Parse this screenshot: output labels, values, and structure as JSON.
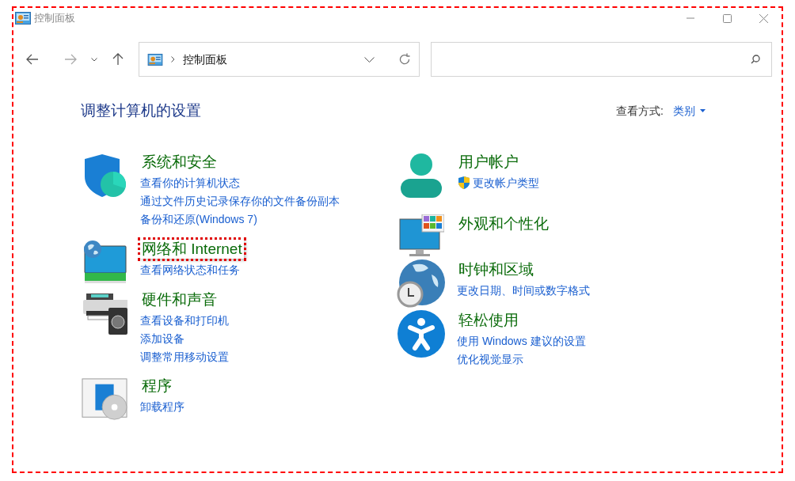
{
  "window": {
    "title": "控制面板"
  },
  "address_bar": {
    "path": "控制面板"
  },
  "heading": "调整计算机的设置",
  "view_by": {
    "label": "查看方式:",
    "value": "类别"
  },
  "columns": [
    [
      {
        "title": "系统和安全",
        "highlighted": false,
        "links": [
          {
            "text": "查看你的计算机状态",
            "shield": false
          },
          {
            "text": "通过文件历史记录保存你的文件备份副本",
            "shield": false
          },
          {
            "text": "备份和还原(Windows 7)",
            "shield": false
          }
        ]
      },
      {
        "title": "网络和 Internet",
        "highlighted": true,
        "links": [
          {
            "text": "查看网络状态和任务",
            "shield": false
          }
        ]
      },
      {
        "title": "硬件和声音",
        "highlighted": false,
        "links": [
          {
            "text": "查看设备和打印机",
            "shield": false
          },
          {
            "text": "添加设备",
            "shield": false
          },
          {
            "text": "调整常用移动设置",
            "shield": false
          }
        ]
      },
      {
        "title": "程序",
        "highlighted": false,
        "links": [
          {
            "text": "卸载程序",
            "shield": false
          }
        ]
      }
    ],
    [
      {
        "title": "用户帐户",
        "highlighted": false,
        "links": [
          {
            "text": "更改帐户类型",
            "shield": true
          }
        ]
      },
      {
        "title": "外观和个性化",
        "highlighted": false
      },
      {
        "title": "时钟和区域",
        "highlighted": false,
        "links": [
          {
            "text": "更改日期、时间或数字格式",
            "shield": false
          }
        ]
      },
      {
        "title": "轻松使用",
        "highlighted": false,
        "links": [
          {
            "text": "使用 Windows 建议的设置",
            "shield": false
          },
          {
            "text": "优化视觉显示",
            "shield": false
          }
        ]
      }
    ]
  ]
}
